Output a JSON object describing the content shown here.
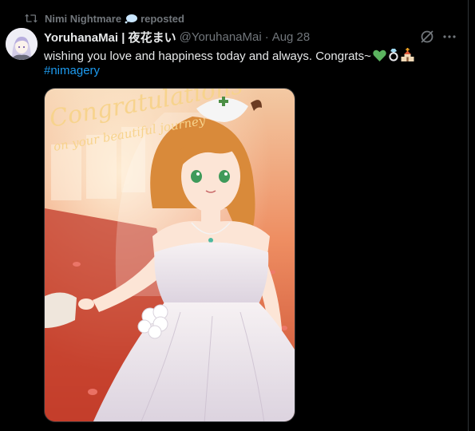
{
  "repost": {
    "reposter": "Nimi Nightmare",
    "label": "reposted",
    "icon": "repost-icon",
    "badge_icon": "speech-bubble-icon"
  },
  "tweet": {
    "display_name": "YoruhanaMai | 夜花まい",
    "handle": "@YoruhanaMai",
    "separator": "·",
    "timestamp": "Aug 28",
    "text": "wishing you love and happiness today and always. Congrats~",
    "emojis": [
      "green-heart-icon",
      "ring-icon",
      "church-icon"
    ],
    "hashtag": "#nimagery",
    "media": {
      "caption_line1": "Congratulations",
      "caption_line2": "on your beautiful journey"
    }
  },
  "actions": {
    "grok_icon": "grok-icon",
    "more_icon": "more-icon"
  },
  "colors": {
    "background": "#000000",
    "text_primary": "#e7e9ea",
    "text_secondary": "#71767b",
    "link": "#1d9bf0",
    "divider": "#2f3336"
  }
}
